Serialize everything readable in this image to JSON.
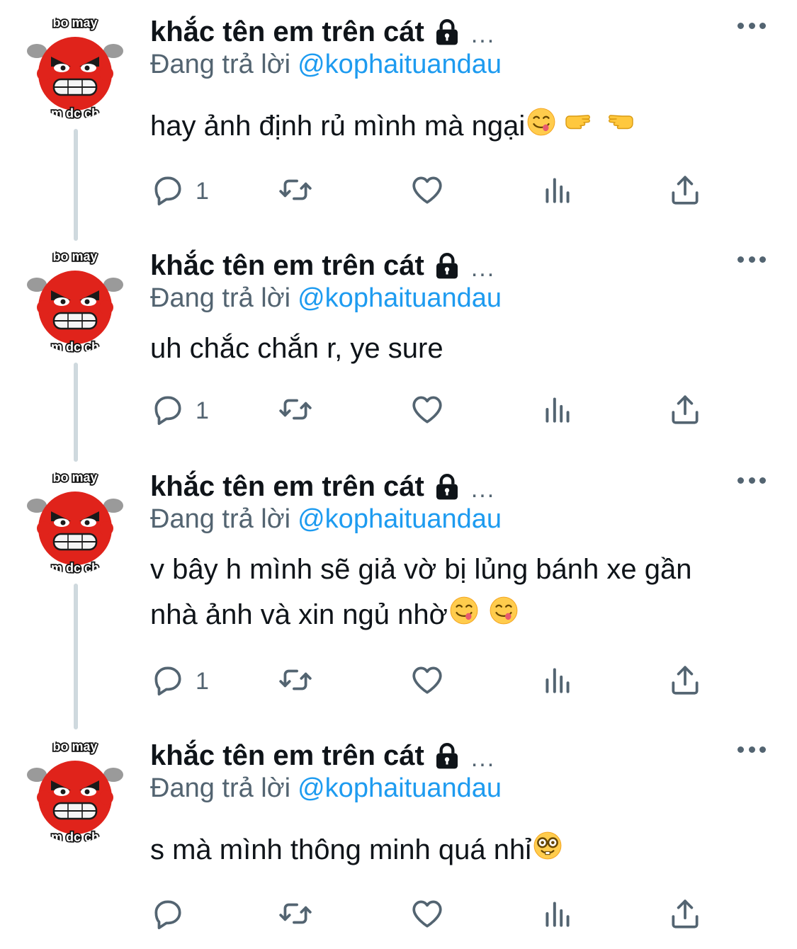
{
  "thread": [
    {
      "display_name": "khắc tên em trên cát",
      "ellipsis": "...",
      "reply_prefix": "Đang trả lời",
      "reply_handle": "@kophaituandau",
      "avatar_text_top": "bo may",
      "avatar_text_bottom": "m dc ch",
      "lines": [
        "hay ảnh định rủ mình mà ngại"
      ],
      "emojis": [
        "yum-face",
        "pointing-right",
        "pointing-left"
      ],
      "reply_count": "1",
      "retweet_count": "",
      "like_count": "",
      "views_count": ""
    },
    {
      "display_name": "khắc tên em trên cát",
      "ellipsis": "...",
      "reply_prefix": "Đang trả lời",
      "reply_handle": "@kophaituandau",
      "avatar_text_top": "bo may",
      "avatar_text_bottom": "m dc ch",
      "lines": [
        "uh chắc chắn r, ye sure"
      ],
      "emojis": [],
      "reply_count": "1",
      "retweet_count": "",
      "like_count": "",
      "views_count": ""
    },
    {
      "display_name": "khắc tên em trên cát",
      "ellipsis": "...",
      "reply_prefix": "Đang trả lời",
      "reply_handle": "@kophaituandau",
      "avatar_text_top": "bo may",
      "avatar_text_bottom": "m dc ch",
      "lines": [
        "v bây h mình sẽ giả vờ bị lủng bánh xe gần",
        "nhà ảnh và xin ngủ nhờ"
      ],
      "emojis": [
        "yum-face",
        "yum-face"
      ],
      "reply_count": "1",
      "retweet_count": "",
      "like_count": "",
      "views_count": ""
    },
    {
      "display_name": "khắc tên em trên cát",
      "ellipsis": "...",
      "reply_prefix": "Đang trả lời",
      "reply_handle": "@kophaituandau",
      "avatar_text_top": "bo may",
      "avatar_text_bottom": "m dc ch",
      "lines": [
        "s mà mình thông minh quá nhỉ"
      ],
      "emojis": [
        "nerd-face"
      ],
      "reply_count": "",
      "retweet_count": "",
      "like_count": "",
      "views_count": ""
    }
  ],
  "colors": {
    "text": "#0f1419",
    "secondary": "#536471",
    "link": "#1d9bf0",
    "thread_line": "#cfd9de"
  },
  "icons": [
    "reply-icon",
    "retweet-icon",
    "like-icon",
    "views-icon",
    "share-icon",
    "lock-icon",
    "more-icon"
  ]
}
